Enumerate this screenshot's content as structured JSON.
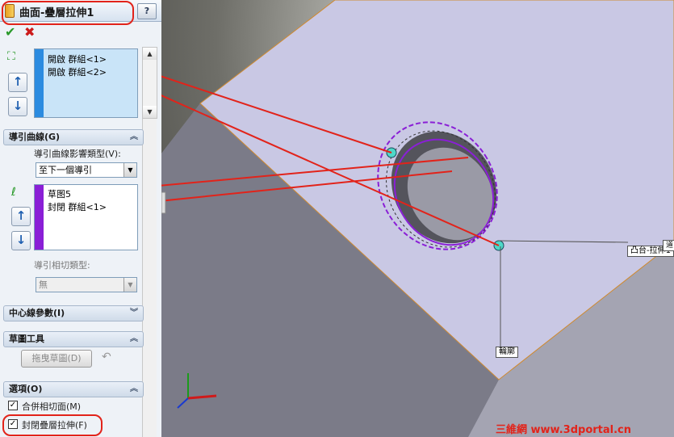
{
  "header": {
    "title": "曲面-疊層拉伸1",
    "help_label": "?"
  },
  "actions": {
    "ok_label": "✔",
    "cancel_label": "✖"
  },
  "profiles": {
    "items": [
      "開啟 群組<1>",
      "開啟 群組<2>"
    ]
  },
  "guides": {
    "heading": "導引曲線(G)",
    "influence_label": "導引曲線影響類型(V):",
    "influence_value": "至下一個導引",
    "items": [
      "草图5",
      "封閉 群組<1>"
    ],
    "tangency_label": "導引相切類型:",
    "tangency_value": "無"
  },
  "centerline": {
    "heading": "中心線參數(I)"
  },
  "sketch_tools": {
    "heading": "草圖工具",
    "drag_sketch_label": "拖曳草圖(D)"
  },
  "options": {
    "heading": "選項(O)",
    "merge_label": "合併相切面(M)",
    "merge_checked": true,
    "close_label": "封閉疊層拉伸(F)",
    "close_checked": true
  },
  "viewport": {
    "boss_label": "凸台-拉伸1",
    "profile_label": "輪廓",
    "corner_tag": "道",
    "watermark": "三維網 www.3dportal.cn"
  },
  "colors": {
    "annotation_red": "#e2231a",
    "guide_bar": "#8a1fd6",
    "profile_bar": "#2b8be0",
    "part_top": "#c9c8e4"
  }
}
